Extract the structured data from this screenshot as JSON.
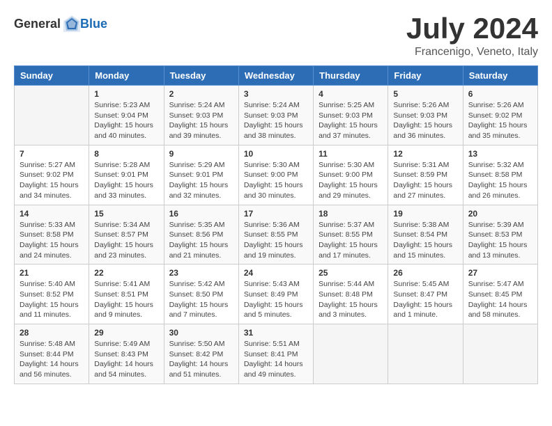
{
  "header": {
    "logo_general": "General",
    "logo_blue": "Blue",
    "month": "July 2024",
    "location": "Francenigo, Veneto, Italy"
  },
  "days_of_week": [
    "Sunday",
    "Monday",
    "Tuesday",
    "Wednesday",
    "Thursday",
    "Friday",
    "Saturday"
  ],
  "weeks": [
    [
      {
        "day": "",
        "info": ""
      },
      {
        "day": "1",
        "info": "Sunrise: 5:23 AM\nSunset: 9:04 PM\nDaylight: 15 hours\nand 40 minutes."
      },
      {
        "day": "2",
        "info": "Sunrise: 5:24 AM\nSunset: 9:03 PM\nDaylight: 15 hours\nand 39 minutes."
      },
      {
        "day": "3",
        "info": "Sunrise: 5:24 AM\nSunset: 9:03 PM\nDaylight: 15 hours\nand 38 minutes."
      },
      {
        "day": "4",
        "info": "Sunrise: 5:25 AM\nSunset: 9:03 PM\nDaylight: 15 hours\nand 37 minutes."
      },
      {
        "day": "5",
        "info": "Sunrise: 5:26 AM\nSunset: 9:03 PM\nDaylight: 15 hours\nand 36 minutes."
      },
      {
        "day": "6",
        "info": "Sunrise: 5:26 AM\nSunset: 9:02 PM\nDaylight: 15 hours\nand 35 minutes."
      }
    ],
    [
      {
        "day": "7",
        "info": "Sunrise: 5:27 AM\nSunset: 9:02 PM\nDaylight: 15 hours\nand 34 minutes."
      },
      {
        "day": "8",
        "info": "Sunrise: 5:28 AM\nSunset: 9:01 PM\nDaylight: 15 hours\nand 33 minutes."
      },
      {
        "day": "9",
        "info": "Sunrise: 5:29 AM\nSunset: 9:01 PM\nDaylight: 15 hours\nand 32 minutes."
      },
      {
        "day": "10",
        "info": "Sunrise: 5:30 AM\nSunset: 9:00 PM\nDaylight: 15 hours\nand 30 minutes."
      },
      {
        "day": "11",
        "info": "Sunrise: 5:30 AM\nSunset: 9:00 PM\nDaylight: 15 hours\nand 29 minutes."
      },
      {
        "day": "12",
        "info": "Sunrise: 5:31 AM\nSunset: 8:59 PM\nDaylight: 15 hours\nand 27 minutes."
      },
      {
        "day": "13",
        "info": "Sunrise: 5:32 AM\nSunset: 8:58 PM\nDaylight: 15 hours\nand 26 minutes."
      }
    ],
    [
      {
        "day": "14",
        "info": "Sunrise: 5:33 AM\nSunset: 8:58 PM\nDaylight: 15 hours\nand 24 minutes."
      },
      {
        "day": "15",
        "info": "Sunrise: 5:34 AM\nSunset: 8:57 PM\nDaylight: 15 hours\nand 23 minutes."
      },
      {
        "day": "16",
        "info": "Sunrise: 5:35 AM\nSunset: 8:56 PM\nDaylight: 15 hours\nand 21 minutes."
      },
      {
        "day": "17",
        "info": "Sunrise: 5:36 AM\nSunset: 8:55 PM\nDaylight: 15 hours\nand 19 minutes."
      },
      {
        "day": "18",
        "info": "Sunrise: 5:37 AM\nSunset: 8:55 PM\nDaylight: 15 hours\nand 17 minutes."
      },
      {
        "day": "19",
        "info": "Sunrise: 5:38 AM\nSunset: 8:54 PM\nDaylight: 15 hours\nand 15 minutes."
      },
      {
        "day": "20",
        "info": "Sunrise: 5:39 AM\nSunset: 8:53 PM\nDaylight: 15 hours\nand 13 minutes."
      }
    ],
    [
      {
        "day": "21",
        "info": "Sunrise: 5:40 AM\nSunset: 8:52 PM\nDaylight: 15 hours\nand 11 minutes."
      },
      {
        "day": "22",
        "info": "Sunrise: 5:41 AM\nSunset: 8:51 PM\nDaylight: 15 hours\nand 9 minutes."
      },
      {
        "day": "23",
        "info": "Sunrise: 5:42 AM\nSunset: 8:50 PM\nDaylight: 15 hours\nand 7 minutes."
      },
      {
        "day": "24",
        "info": "Sunrise: 5:43 AM\nSunset: 8:49 PM\nDaylight: 15 hours\nand 5 minutes."
      },
      {
        "day": "25",
        "info": "Sunrise: 5:44 AM\nSunset: 8:48 PM\nDaylight: 15 hours\nand 3 minutes."
      },
      {
        "day": "26",
        "info": "Sunrise: 5:45 AM\nSunset: 8:47 PM\nDaylight: 15 hours\nand 1 minute."
      },
      {
        "day": "27",
        "info": "Sunrise: 5:47 AM\nSunset: 8:45 PM\nDaylight: 14 hours\nand 58 minutes."
      }
    ],
    [
      {
        "day": "28",
        "info": "Sunrise: 5:48 AM\nSunset: 8:44 PM\nDaylight: 14 hours\nand 56 minutes."
      },
      {
        "day": "29",
        "info": "Sunrise: 5:49 AM\nSunset: 8:43 PM\nDaylight: 14 hours\nand 54 minutes."
      },
      {
        "day": "30",
        "info": "Sunrise: 5:50 AM\nSunset: 8:42 PM\nDaylight: 14 hours\nand 51 minutes."
      },
      {
        "day": "31",
        "info": "Sunrise: 5:51 AM\nSunset: 8:41 PM\nDaylight: 14 hours\nand 49 minutes."
      },
      {
        "day": "",
        "info": ""
      },
      {
        "day": "",
        "info": ""
      },
      {
        "day": "",
        "info": ""
      }
    ]
  ]
}
